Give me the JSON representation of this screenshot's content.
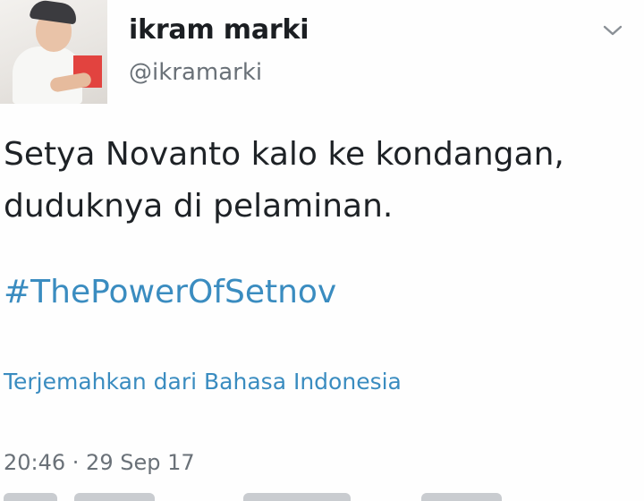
{
  "tweet": {
    "author": {
      "display_name": "ikram marki",
      "handle": "@ikramarki"
    },
    "menu_icon": "chevron-down-icon",
    "text_lines": [
      "Setya Novanto kalo ke kondangan,",
      "duduknya di pelaminan."
    ],
    "hashtag": "#ThePowerOfSetnov",
    "translate_label": "Terjemahkan dari Bahasa Indonesia",
    "timestamp": "20:46 · 29 Sep 17"
  },
  "colors": {
    "link": "#3a8cc0",
    "muted": "#6a7178",
    "text": "#1e2226"
  }
}
